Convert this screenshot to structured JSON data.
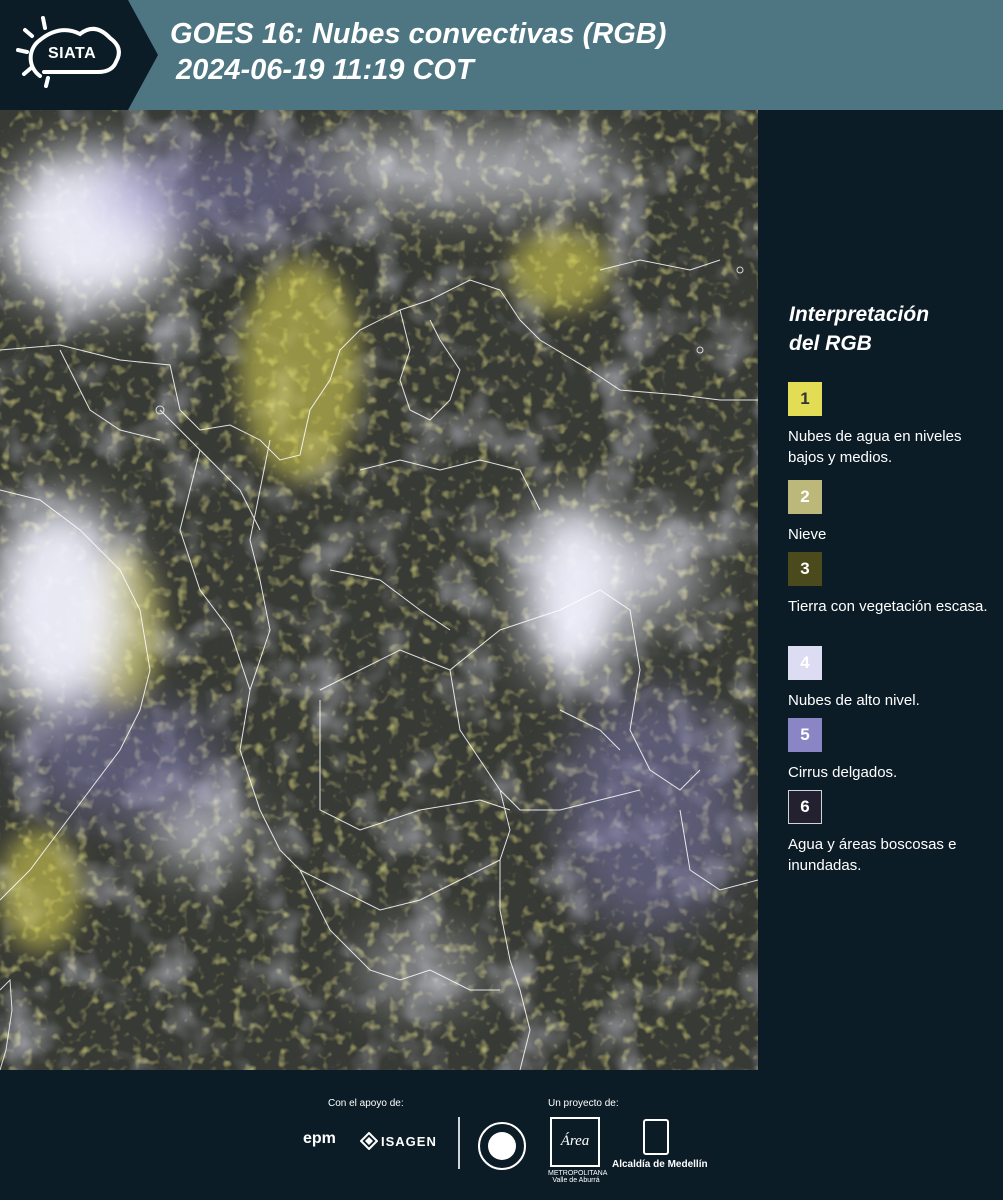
{
  "header": {
    "logo_text": "SIATA",
    "title_line1": "GOES 16: Nubes convectivas (RGB)",
    "title_line2": "2024-06-19 11:19 COT"
  },
  "legend": {
    "title_line1": "Interpretación",
    "title_line2": "del RGB",
    "items": [
      {
        "number": "1",
        "label": "Nubes de agua en niveles bajos y medios.",
        "color": "#e3dc55",
        "text_color": "#333333"
      },
      {
        "number": "2",
        "label": "Nieve",
        "color": "#bcb87a",
        "text_color": "#ffffff"
      },
      {
        "number": "3",
        "label": "Tierra con vegetación escasa.",
        "color": "#4a4a1c",
        "text_color": "#ffffff"
      },
      {
        "number": "4",
        "label": "Nubes de alto nivel.",
        "color": "#dcdcf3",
        "text_color": "#ffffff"
      },
      {
        "number": "5",
        "label": "Cirrus delgados.",
        "color": "#8a86c6",
        "text_color": "#ffffff"
      },
      {
        "number": "6",
        "label": "Agua y áreas boscosas e inundadas.",
        "color": "#23202f",
        "text_color": "#ffffff"
      }
    ]
  },
  "footer": {
    "support_label": "Con el apoyo de:",
    "project_label": "Un proyecto de:",
    "sponsor1": "epm",
    "sponsor2": "ISAGEN",
    "partner_area": "Área",
    "partner_area_sub": "METROPOLITANA Valle de Aburrá",
    "partner_alcaldia": "Alcaldía de Medellín"
  },
  "colors": {
    "header_bg": "#4d7682",
    "panel_bg": "#0c1c27",
    "low_cloud": "#e3dc55",
    "high_cloud": "#dcdcf3"
  }
}
